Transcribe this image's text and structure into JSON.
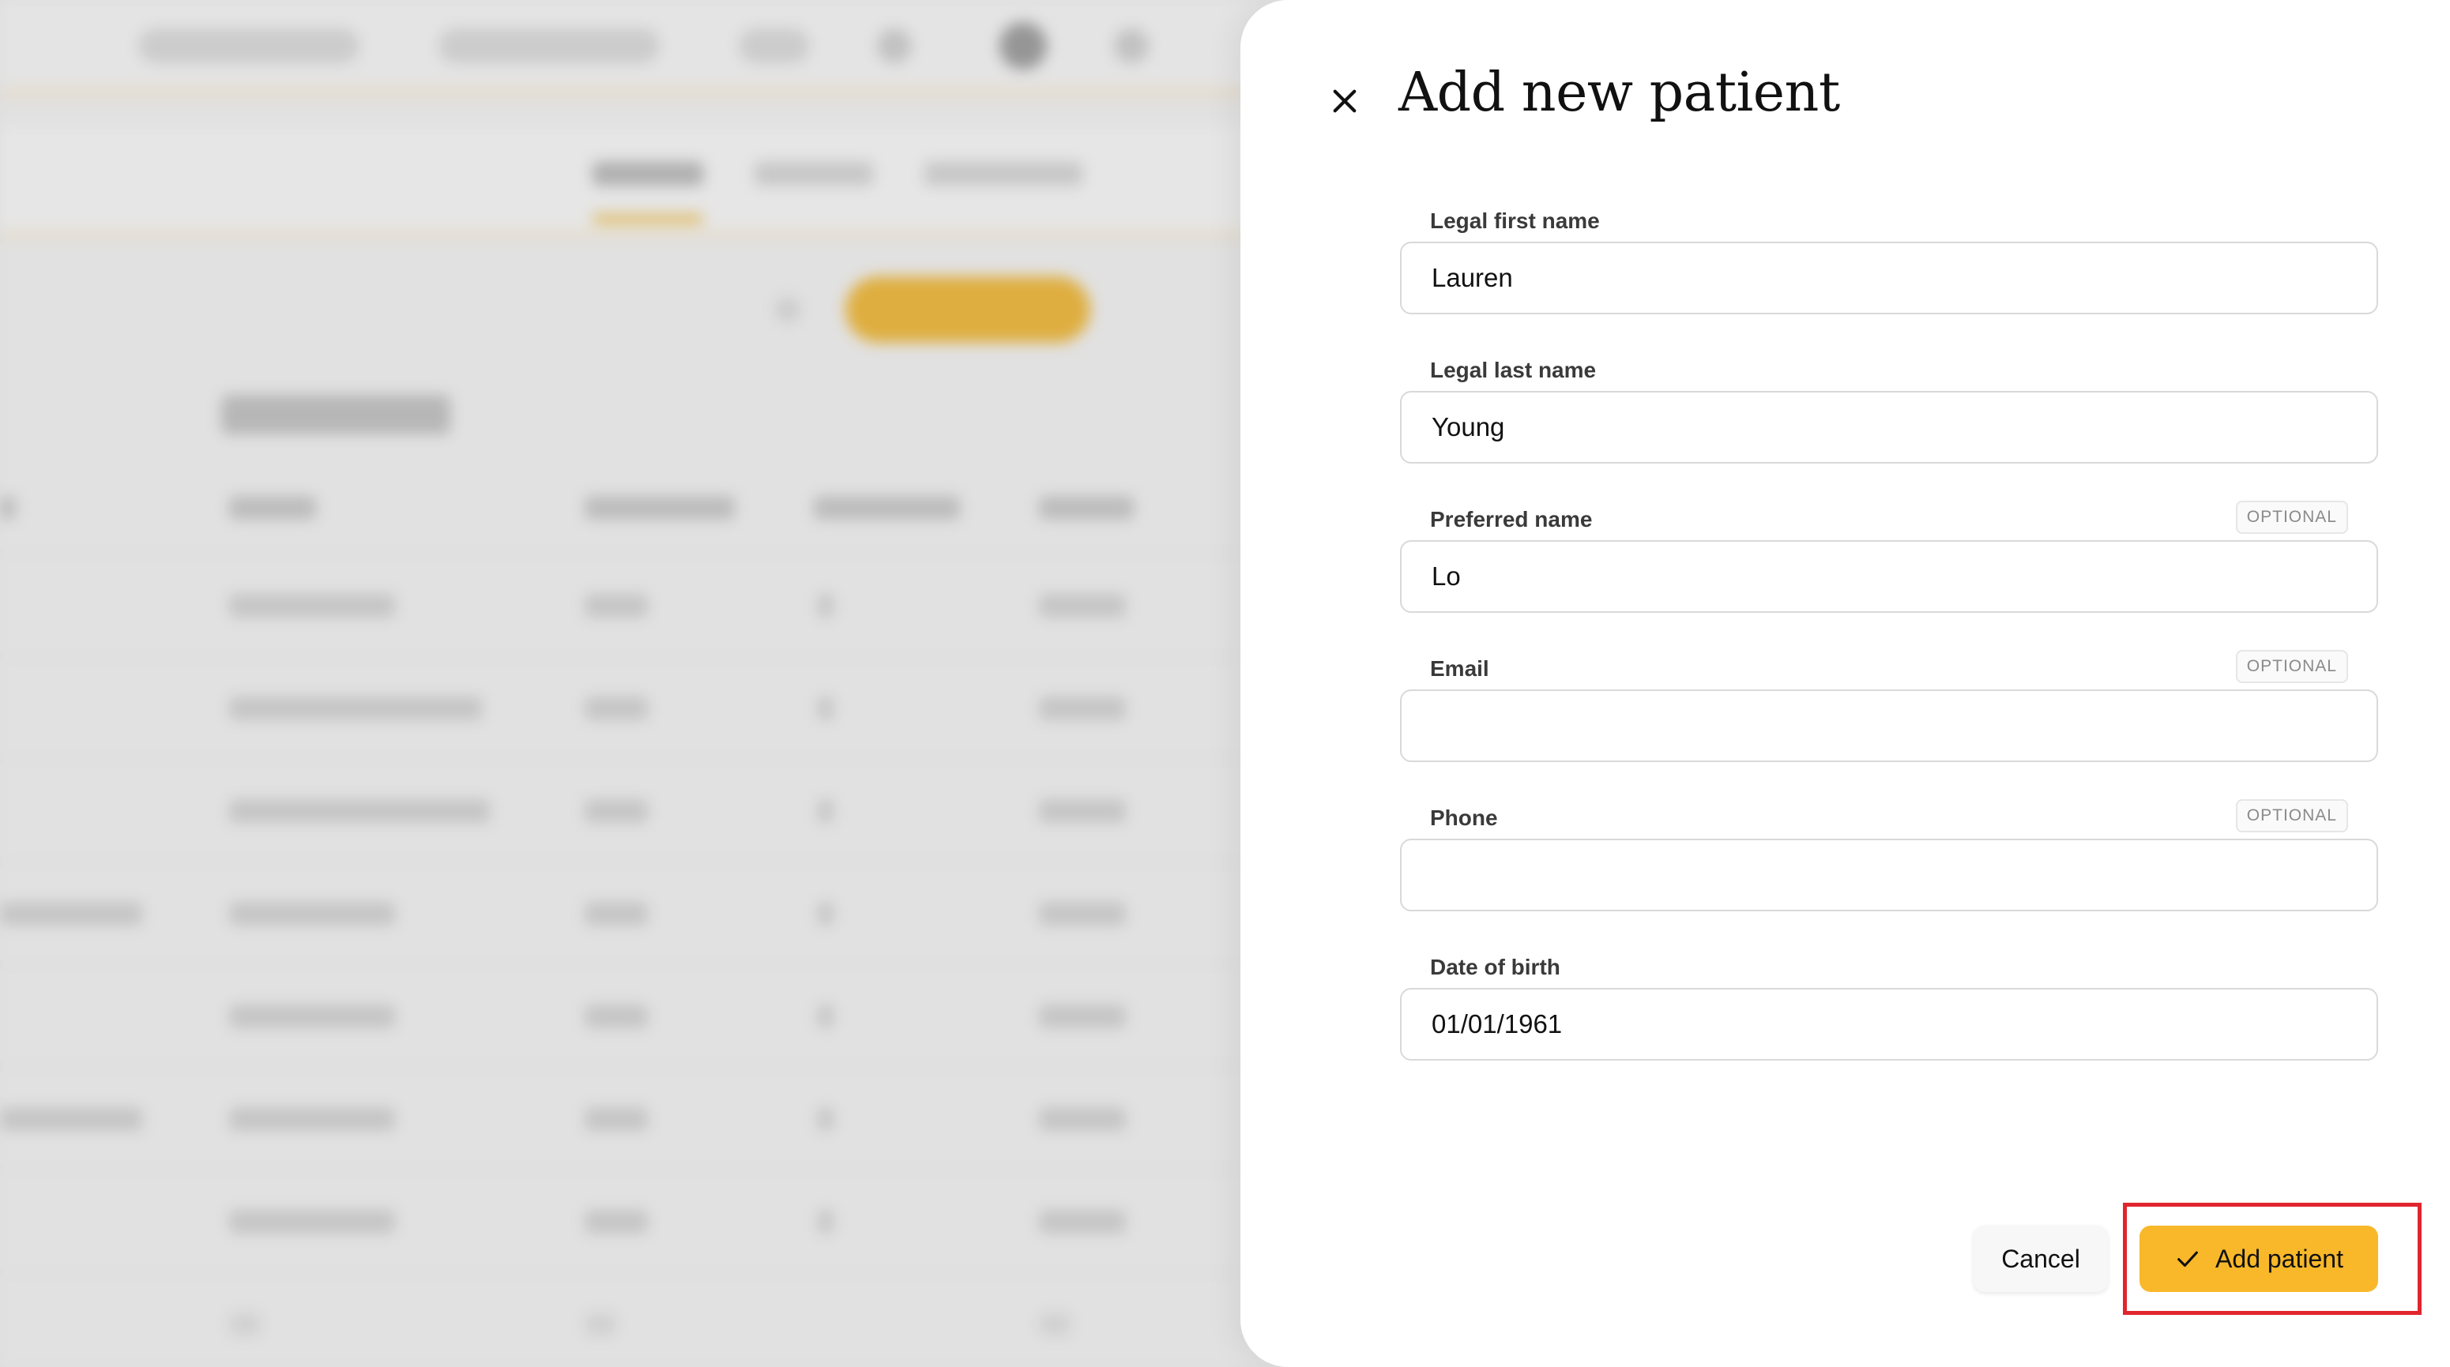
{
  "drawer": {
    "title": "Add new patient"
  },
  "fields": {
    "first_name": {
      "label": "Legal first name",
      "value": "Lauren"
    },
    "last_name": {
      "label": "Legal last name",
      "value": "Young"
    },
    "preferred_name": {
      "label": "Preferred name",
      "badge": "OPTIONAL",
      "value": "Lo"
    },
    "email": {
      "label": "Email",
      "badge": "OPTIONAL",
      "value": ""
    },
    "phone": {
      "label": "Phone",
      "badge": "OPTIONAL",
      "value": ""
    },
    "dob": {
      "label": "Date of birth",
      "value": "01/01/1961"
    }
  },
  "actions": {
    "cancel_label": "Cancel",
    "submit_label": "Add patient"
  },
  "icons": {
    "close": "close-icon",
    "submit": "check-icon"
  },
  "colors": {
    "accent": "#f8b82a",
    "highlight": "#e0252e"
  }
}
